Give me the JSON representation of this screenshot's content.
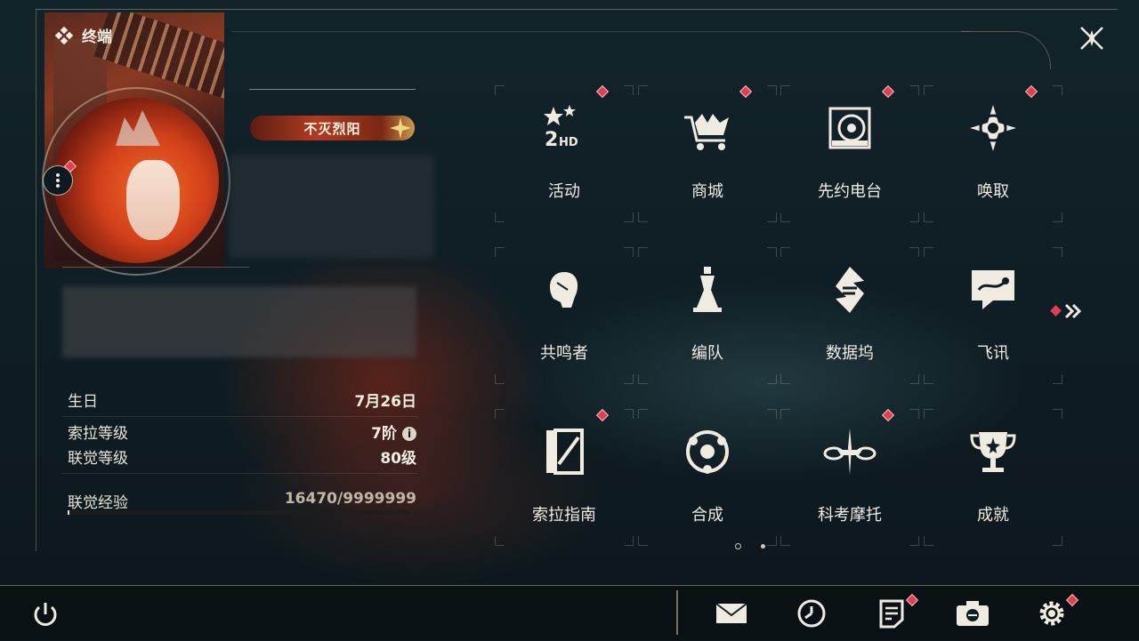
{
  "header": {
    "title": "终端"
  },
  "profile": {
    "title_badge": "不灭烈阳",
    "info": [
      {
        "key": "生日",
        "value": "7月26日"
      },
      {
        "key": "索拉等级",
        "value": "7阶"
      },
      {
        "key": "联觉等级",
        "value": "80级"
      },
      {
        "key": "联觉经验",
        "value": "16470/9999999"
      }
    ],
    "xp_progress_fraction": 0.0016
  },
  "grid": [
    {
      "label": "活动",
      "icon": "event-2hd-icon",
      "badge": true
    },
    {
      "label": "商城",
      "icon": "shop-cart-icon",
      "badge": true
    },
    {
      "label": "先约电台",
      "icon": "radio-icon",
      "badge": true
    },
    {
      "label": "唤取",
      "icon": "summon-compass-icon",
      "badge": true
    },
    {
      "label": "共鸣者",
      "icon": "resonator-head-icon",
      "badge": false
    },
    {
      "label": "编队",
      "icon": "team-chess-icon",
      "badge": false
    },
    {
      "label": "数据坞",
      "icon": "data-dock-icon",
      "badge": false
    },
    {
      "label": "飞讯",
      "icon": "message-chat-icon",
      "badge": false
    },
    {
      "label": "索拉指南",
      "icon": "guide-book-icon",
      "badge": true
    },
    {
      "label": "合成",
      "icon": "synthesis-icon",
      "badge": false
    },
    {
      "label": "科考摩托",
      "icon": "motorbike-icon",
      "badge": true
    },
    {
      "label": "成就",
      "icon": "trophy-icon",
      "badge": false
    }
  ],
  "pager": {
    "current": 1,
    "total": 2
  },
  "bottom_bar": [
    "mail-icon",
    "clock-icon",
    "notes-icon",
    "camera-icon",
    "settings-gear-icon"
  ],
  "colors": {
    "badge_red": "#e0404e",
    "accent_gold": "#c8b48c",
    "text": "#e9e4da"
  }
}
